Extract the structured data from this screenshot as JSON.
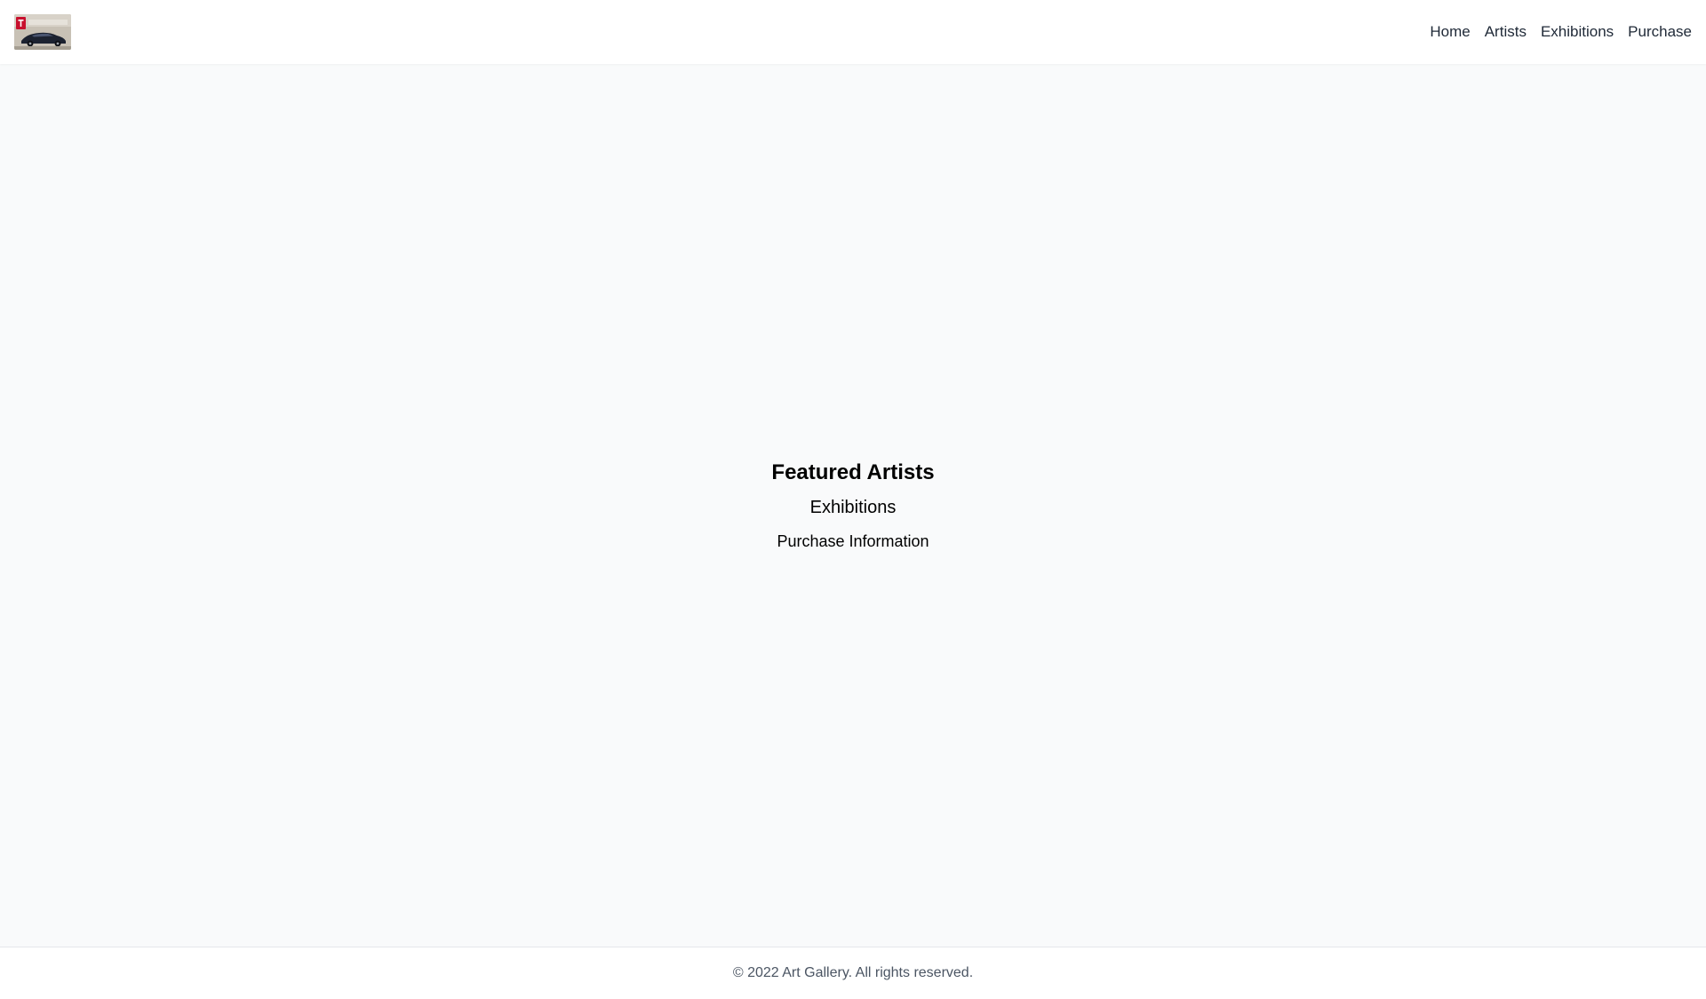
{
  "header": {
    "nav": [
      {
        "label": "Home"
      },
      {
        "label": "Artists"
      },
      {
        "label": "Exhibitions"
      },
      {
        "label": "Purchase"
      }
    ]
  },
  "main": {
    "featured_title": "Featured Artists",
    "exhibitions_title": "Exhibitions",
    "purchase_title": "Purchase Information"
  },
  "footer": {
    "copyright": "© 2022 Art Gallery. All rights reserved."
  },
  "colors": {
    "page_background": "#f9fafb",
    "header_background": "#ffffff",
    "nav_text": "#1f2937",
    "footer_text": "#4b5563"
  }
}
